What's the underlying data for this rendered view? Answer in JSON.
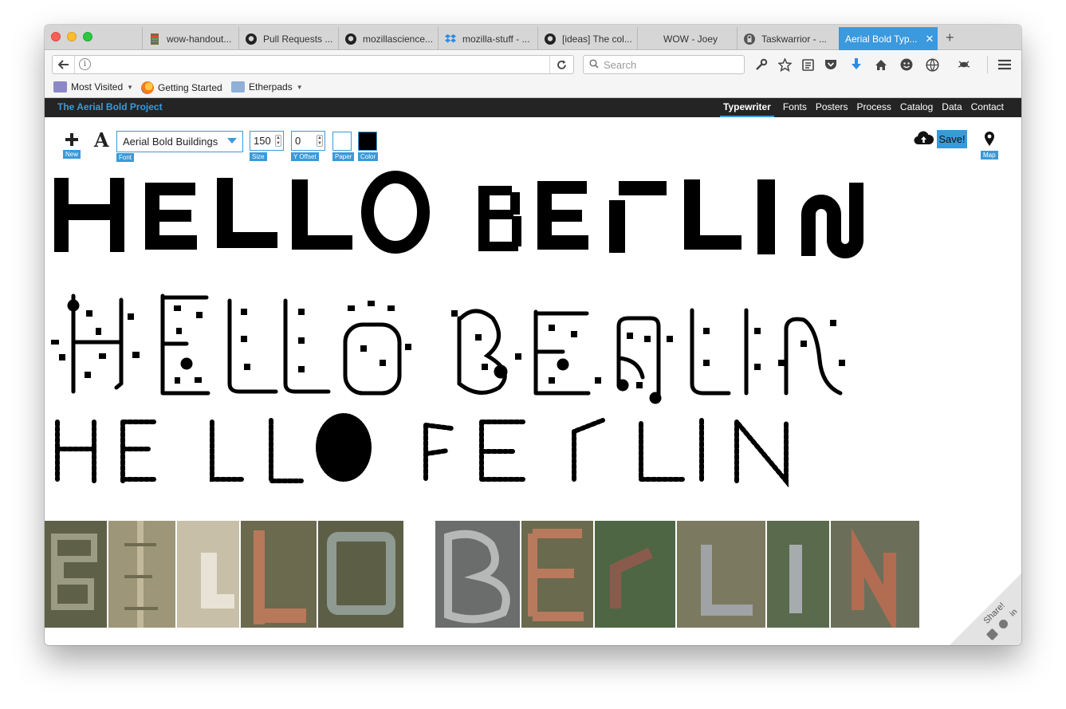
{
  "browser": {
    "tabs": [
      {
        "label": "wow-handout...",
        "icon": "notebook-icon"
      },
      {
        "label": "Pull Requests ...",
        "icon": "github-icon"
      },
      {
        "label": "mozillascience...",
        "icon": "github-icon"
      },
      {
        "label": "mozilla-stuff - ...",
        "icon": "dropbox-icon"
      },
      {
        "label": "[ideas] The col...",
        "icon": "github-icon"
      },
      {
        "label": "WOW - Joey",
        "icon": ""
      },
      {
        "label": "Taskwarrior - ...",
        "icon": "lock-icon"
      },
      {
        "label": "Aerial Bold Typ...",
        "icon": "",
        "active": true
      }
    ],
    "new_tab": "+",
    "search_placeholder": "Search",
    "bookmarks": [
      {
        "label": "Most Visited",
        "icon": "folder-icon",
        "dropdown": true
      },
      {
        "label": "Getting Started",
        "icon": "firefox-icon",
        "dropdown": false
      },
      {
        "label": "Etherpads",
        "icon": "folder-icon",
        "dropdown": true
      }
    ]
  },
  "site": {
    "brand": "The Aerial Bold Project",
    "menu": [
      "Typewriter",
      "Fonts",
      "Posters",
      "Process",
      "Catalog",
      "Data",
      "Contact"
    ],
    "active_menu": "Typewriter"
  },
  "toolbar": {
    "new_label": "New",
    "font_label": "Font",
    "font_value": "Aerial Bold Buildings",
    "size_label": "Size",
    "size_value": "150",
    "yoffset_label": "Y Offset",
    "yoffset_value": "0",
    "paper_label": "Paper",
    "paper_color": "#ffffff",
    "color_label": "Color",
    "color_value": "#000000",
    "save_label": "Save!",
    "map_label": "Map"
  },
  "preview": {
    "text": "HELLO BERLIN",
    "styles": [
      "buildings",
      "roads",
      "trees",
      "satellite"
    ]
  },
  "share": {
    "label": "Share!"
  },
  "colors": {
    "accent": "#3a9ad9",
    "header_bg": "#242424"
  }
}
